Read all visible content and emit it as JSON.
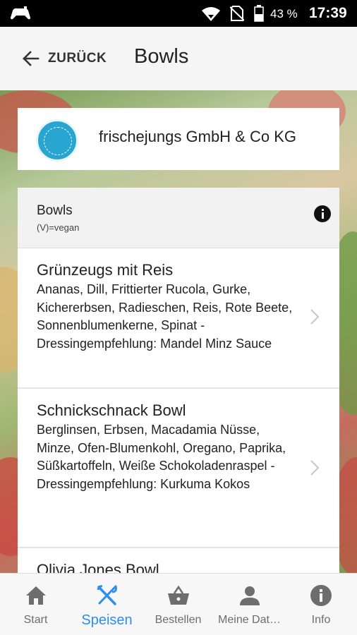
{
  "status_bar": {
    "battery": "43 %",
    "time": "17:39"
  },
  "header": {
    "back_label": "ZURÜCK",
    "title": "Bowls"
  },
  "vendor": {
    "name": "frischejungs GmbH & Co KG"
  },
  "category": {
    "title": "Bowls",
    "subtitle": "(V)=vegan"
  },
  "items": [
    {
      "name": "Grünzeugs mit Reis",
      "desc": "Ananas, Dill, Frittierter Rucola, Gurke, Kichererbsen, Radieschen, Reis, Rote Beete, Sonnenblumenkerne, Spinat - Dressingempfehlung: Mandel Minz Sauce"
    },
    {
      "name": "Schnickschnack Bowl",
      "desc": "Berglinsen, Erbsen, Macadamia Nüsse, Minze, Ofen-Blumenkohl, Oregano, Paprika, Süßkartoffeln, Weiße Schokoladenraspel - Dressingempfehlung: Kurkuma Kokos"
    },
    {
      "name": "Olivia Jones Bowl",
      "desc": ""
    }
  ],
  "nav": {
    "start": "Start",
    "speisen": "Speisen",
    "bestellen": "Bestellen",
    "meine_daten": "Meine Dat…",
    "info": "Info"
  },
  "colors": {
    "accent": "#2e8ee9",
    "nav_inactive": "#6d6d6d",
    "logo": "#29a5d2"
  }
}
